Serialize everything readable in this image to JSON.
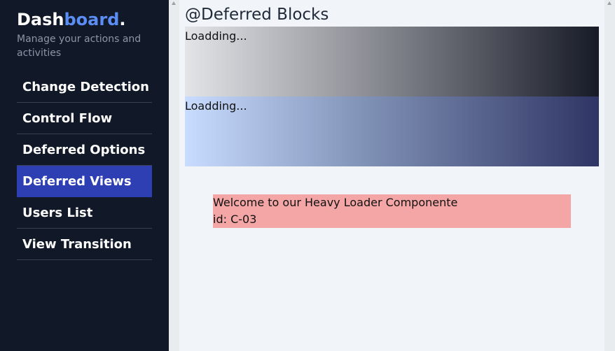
{
  "sidebar": {
    "brand_main": "Dash",
    "brand_accent": "board",
    "brand_dot": ".",
    "subtitle": "Manage your actions and activities",
    "items": [
      {
        "label": "Change Detection",
        "active": false
      },
      {
        "label": "Control Flow",
        "active": false
      },
      {
        "label": "Deferred Options",
        "active": false
      },
      {
        "label": "Deferred Views",
        "active": true
      },
      {
        "label": "Users List",
        "active": false
      },
      {
        "label": "View Transition",
        "active": false
      }
    ]
  },
  "main": {
    "title": "@Deferred Blocks",
    "blocks": [
      {
        "label": "Loadding..."
      },
      {
        "label": "Loadding..."
      }
    ],
    "heavy_loader": {
      "line1": "Welcome to our Heavy Loader Componente",
      "line2": "id: C-03"
    }
  },
  "colors": {
    "sidebar_bg": "#111827",
    "accent": "#5b8ef5",
    "active_item": "#2e3fb4",
    "heavy_loader_bg": "#f4a6a6"
  }
}
